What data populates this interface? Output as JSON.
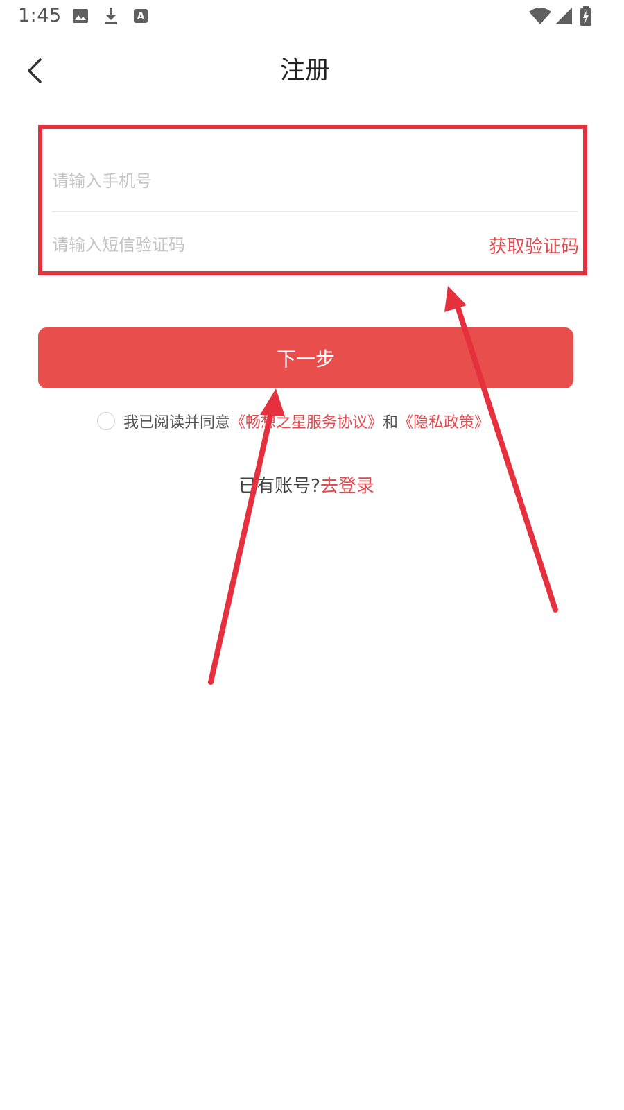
{
  "status_bar": {
    "time": "1:45",
    "icons": [
      "image-icon",
      "download-icon",
      "text-a-icon",
      "wifi-icon",
      "signal-icon",
      "battery-charging-icon"
    ]
  },
  "header": {
    "title": "注册",
    "back_icon": "chevron-left-icon"
  },
  "form": {
    "phone_placeholder": "请输入手机号",
    "phone_value": "",
    "code_placeholder": "请输入短信验证码",
    "code_value": "",
    "get_code_label": "获取验证码"
  },
  "next_button": {
    "label": "下一步"
  },
  "agreement": {
    "prefix": "我已阅读并同意",
    "service_link": "《畅想之星服务协议》",
    "conjunction": "和",
    "privacy_link": "《隐私政策》",
    "checked": false
  },
  "login": {
    "prompt": "已有账号?",
    "link": "去登录"
  },
  "colors": {
    "accent": "#e84f4c",
    "annotation": "#e5303e",
    "link": "#e5484d"
  }
}
